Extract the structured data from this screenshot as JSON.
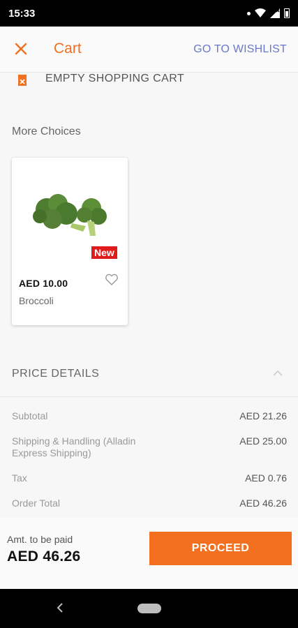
{
  "status_bar": {
    "time": "15:33"
  },
  "header": {
    "title": "Cart",
    "wishlist_link": "GO TO WISHLIST"
  },
  "cart": {
    "empty_label": "EMPTY SHOPPING CART"
  },
  "more_choices": {
    "heading": "More Choices",
    "products": [
      {
        "name": "Broccoli",
        "price": "AED 10.00",
        "badge": "New"
      }
    ]
  },
  "price_details": {
    "heading": "PRICE DETAILS",
    "rows": [
      {
        "label": "Subtotal",
        "value": "AED 21.26"
      },
      {
        "label": "Shipping & Handling (Alladin Express Shipping)",
        "value": "AED 25.00"
      },
      {
        "label": "Tax",
        "value": "AED 0.76"
      },
      {
        "label": "Order Total",
        "value": "AED 46.26"
      }
    ]
  },
  "footer": {
    "amount_label": "Amt. to be paid",
    "amount_value": "AED 46.26",
    "proceed_label": "PROCEED"
  },
  "colors": {
    "accent": "#f37021",
    "link": "#6a7ac9",
    "badge": "#e01b1b"
  }
}
